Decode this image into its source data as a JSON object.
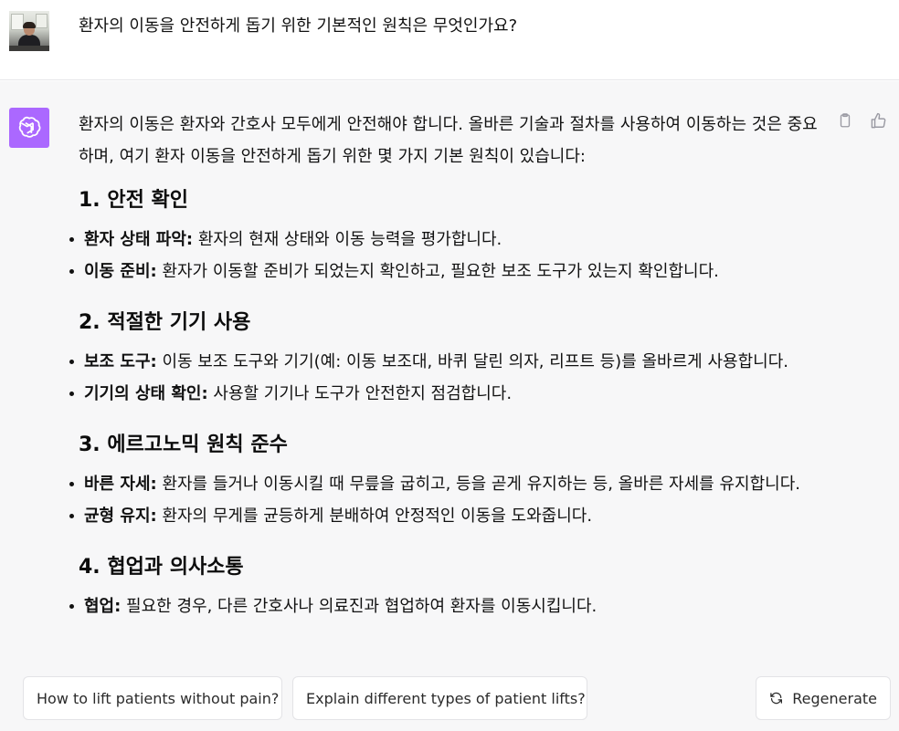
{
  "user": {
    "question": "환자의 이동을 안전하게 돕기 위한 기본적인 원칙은 무엇인가요?"
  },
  "assistant": {
    "intro": "환자의 이동은 환자와 간호사 모두에게 안전해야 합니다. 올바른 기술과 절차를 사용하여 이동하는 것은 중요하며, 여기 환자 이동을 안전하게 돕기 위한 몇 가지 기본 원칙이 있습니다:",
    "sections": [
      {
        "heading": "1. 안전 확인",
        "items": [
          {
            "term": "환자 상태 파악:",
            "text": " 환자의 현재 상태와 이동 능력을 평가합니다."
          },
          {
            "term": "이동 준비:",
            "text": " 환자가 이동할 준비가 되었는지 확인하고, 필요한 보조 도구가 있는지 확인합니다."
          }
        ]
      },
      {
        "heading": "2. 적절한 기기 사용",
        "items": [
          {
            "term": "보조 도구:",
            "text": " 이동 보조 도구와 기기(예: 이동 보조대, 바퀴 달린 의자, 리프트 등)를 올바르게 사용합니다."
          },
          {
            "term": "기기의 상태 확인:",
            "text": " 사용할 기기나 도구가 안전한지 점검합니다."
          }
        ]
      },
      {
        "heading": "3. 에르고노믹 원칙 준수",
        "items": [
          {
            "term": "바른 자세:",
            "text": " 환자를 들거나 이동시킬 때 무릎을 굽히고, 등을 곧게 유지하는 등, 올바른 자세를 유지합니다."
          },
          {
            "term": "균형 유지:",
            "text": " 환자의 무게를 균등하게 분배하여 안정적인 이동을 도와줍니다."
          }
        ]
      },
      {
        "heading": "4. 협업과 의사소통",
        "items": [
          {
            "term": "협업:",
            "text": " 필요한 경우, 다른 간호사나 의료진과 협업하여 환자를 이동시킵니다."
          }
        ]
      }
    ]
  },
  "suggestions": [
    "How to lift patients without pain?",
    "Explain different types of patient lifts?"
  ],
  "regenerate_label": "Regenerate",
  "icons": [
    "clipboard-icon",
    "thumbs-up-icon",
    "regenerate-icon",
    "openai-logo-icon"
  ],
  "colors": {
    "bot_avatar": "#ab68ff",
    "bot_bg": "#f7f7f8",
    "user_bg": "#ffffff"
  }
}
